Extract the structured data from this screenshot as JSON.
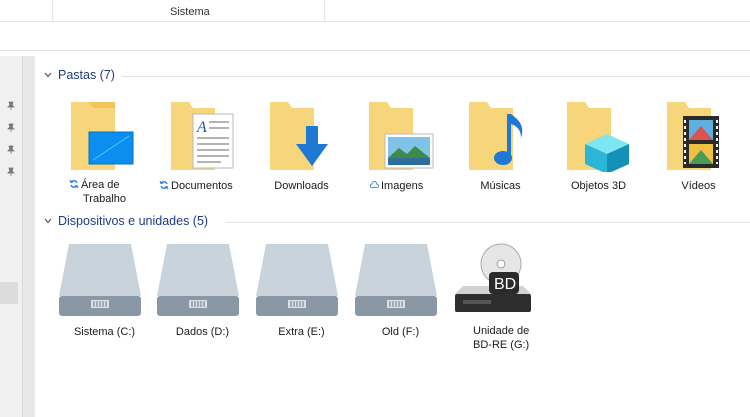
{
  "columns": {
    "sistema": "Sistema"
  },
  "sections": {
    "folders": {
      "title": "Pastas (7)"
    },
    "drives": {
      "title": "Dispositivos e unidades (5)"
    }
  },
  "folders": [
    {
      "line1": "Área de",
      "line2": "Trabalho",
      "sync": "sync-icon"
    },
    {
      "line1": "Documentos",
      "sync": "sync-icon"
    },
    {
      "line1": "Downloads"
    },
    {
      "line1": "Imagens",
      "sync": "cloud-icon"
    },
    {
      "line1": "Músicas"
    },
    {
      "line1": "Objetos 3D"
    },
    {
      "line1": "Vídeos"
    }
  ],
  "drives": [
    {
      "line1": "Sistema (C:)"
    },
    {
      "line1": "Dados (D:)"
    },
    {
      "line1": "Extra (E:)"
    },
    {
      "line1": "Old (F:)"
    },
    {
      "line1": "Unidade de",
      "line2": "BD-RE (G:)",
      "badge": "BD"
    }
  ],
  "colors": {
    "accent": "#1e3b8a",
    "folder": "#f7d67b",
    "sync": "#1e78d4"
  }
}
